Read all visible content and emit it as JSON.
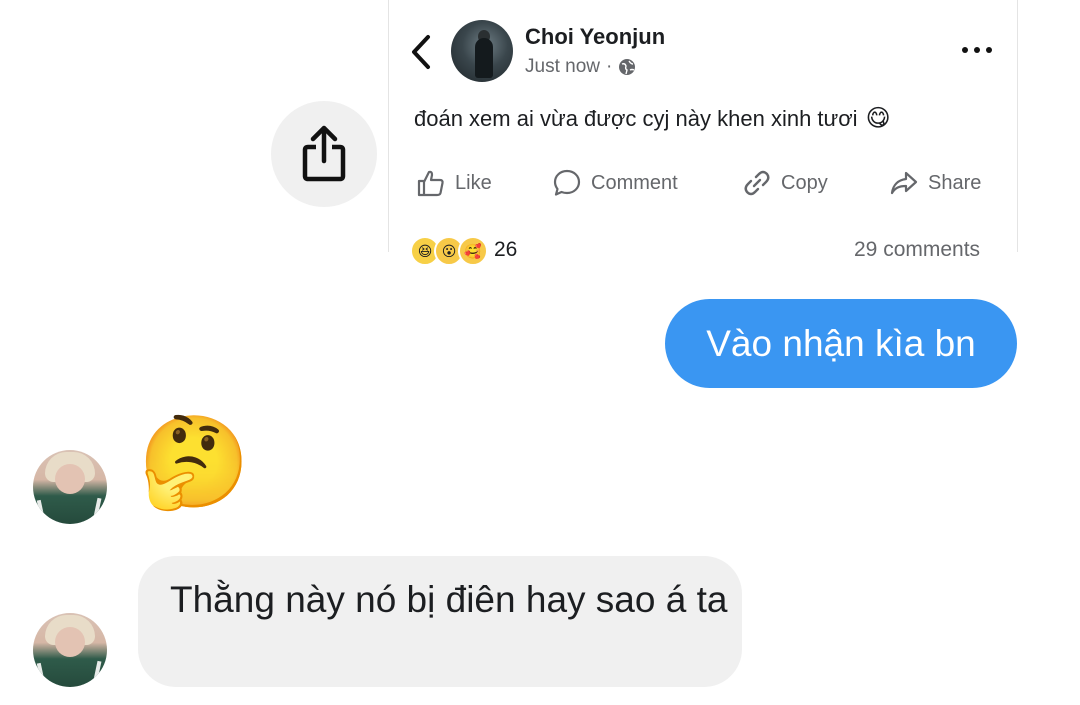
{
  "share_button": {
    "icon": "share-upload-icon"
  },
  "post": {
    "author": "Choi Yeonjun",
    "time": "Just now",
    "privacy_icon": "globe-icon",
    "text": "đoán xem ai vừa được cyj này khen xinh tươi",
    "text_emoji": "😋",
    "actions": {
      "like": "Like",
      "comment": "Comment",
      "copy": "Copy",
      "share": "Share"
    },
    "reactions": {
      "icons": [
        "😆",
        "😮",
        "🥰"
      ],
      "count": "26",
      "comments": "29 comments"
    }
  },
  "messages": {
    "outgoing_1": "Vào nhận kìa bn",
    "incoming_emoji": "🤔",
    "incoming_text": "Thằng này nó bị điên hay sao á ta"
  },
  "colors": {
    "accent": "#3a96f2",
    "bubble_gray": "#f0f0f0",
    "meta_gray": "#65676b"
  }
}
